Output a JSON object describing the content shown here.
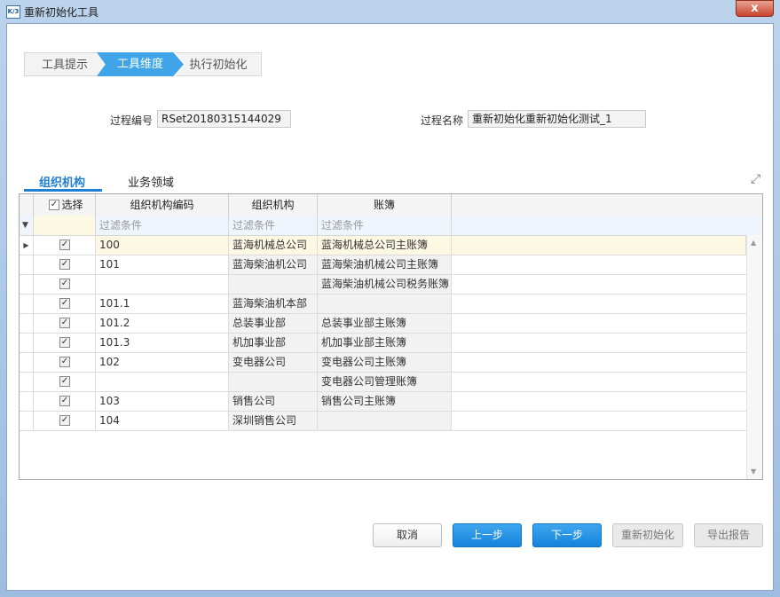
{
  "window": {
    "title": "重新初始化工具",
    "logo_text": "K/3",
    "close_label": "x"
  },
  "steps": [
    "工具提示",
    "工具维度",
    "执行初始化"
  ],
  "active_step": 1,
  "form": {
    "process_no_label": "过程编号",
    "process_no_value": "RSet20180315144029",
    "process_name_label": "过程名称",
    "process_name_value": "重新初始化重新初始化测试_1"
  },
  "tabs": [
    "组织机构",
    "业务领域"
  ],
  "active_tab": 0,
  "grid": {
    "columns": {
      "select": "选择",
      "code": "组织机构编码",
      "org": "组织机构",
      "book": "账簿"
    },
    "filter_placeholder": "过滤条件",
    "rows": [
      {
        "checked": true,
        "code": "100",
        "org": "蓝海机械总公司",
        "book": "蓝海机械总公司主账簿"
      },
      {
        "checked": true,
        "code": "101",
        "org": "蓝海柴油机公司",
        "book": "蓝海柴油机械公司主账簿"
      },
      {
        "checked": true,
        "code": "",
        "org": "",
        "book": "蓝海柴油机械公司税务账簿"
      },
      {
        "checked": true,
        "code": "101.1",
        "org": "蓝海柴油机本部",
        "book": ""
      },
      {
        "checked": true,
        "code": "101.2",
        "org": "总装事业部",
        "book": "总装事业部主账簿"
      },
      {
        "checked": true,
        "code": "101.3",
        "org": "机加事业部",
        "book": "机加事业部主账簿"
      },
      {
        "checked": true,
        "code": "102",
        "org": "变电器公司",
        "book": "变电器公司主账簿"
      },
      {
        "checked": true,
        "code": "",
        "org": "",
        "book": "变电器公司管理账簿"
      },
      {
        "checked": true,
        "code": "103",
        "org": "销售公司",
        "book": "销售公司主账簿"
      },
      {
        "checked": true,
        "code": "104",
        "org": "深圳销售公司",
        "book": ""
      }
    ]
  },
  "buttons": {
    "cancel": "取消",
    "prev": "上一步",
    "next": "下一步",
    "reinit": "重新初始化",
    "export": "导出报告"
  },
  "icons": {
    "expand": "expand-icon",
    "filter": "filter-icon",
    "row_pointer": "row-pointer-icon"
  },
  "colors": {
    "accent": "#3fa4e8",
    "tab_active": "#1e7fd3",
    "selected_row": "#fdf8e4"
  }
}
